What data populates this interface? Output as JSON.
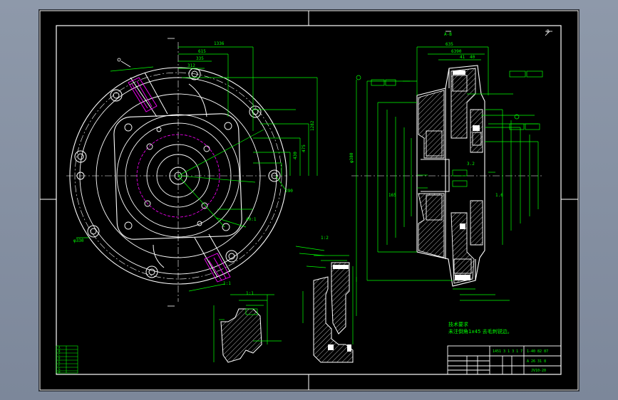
{
  "drawing": {
    "title_block": {
      "top_right_text": "1-40 82 87",
      "name_text": "A 26 31 8",
      "part_no": "JV10-20",
      "company": "1451 3 1 3 1 7"
    },
    "section_labels": {
      "section_ab": "A-B",
      "detail_1": "1:2",
      "detail_view": "1:1",
      "detail_scale": "1:1",
      "corner_mark": "B"
    },
    "dimensions": {
      "top_span": "1336",
      "top_1": "615",
      "top_2": "335",
      "top_3": "312",
      "right_span": "635",
      "right_a": "6390",
      "right_b": "41",
      "right_c": "40",
      "vertical_1": "1282",
      "vertical_2": "475",
      "vertical_3": "430",
      "vertical_4": "290",
      "left_phi": "φ330",
      "left_phi2": "φ380",
      "mid_1": "165",
      "mid_2": "1.6",
      "mid_3": "3.2",
      "scale_label": "40:1"
    },
    "notes": {
      "tech_req_title": "技术要求",
      "tech_req_line": "未注倒角1x45 去毛刺锐边。"
    },
    "legend_box": [
      "A",
      "B",
      "C",
      "D",
      "E",
      "F",
      "G",
      "H"
    ],
    "colors": {
      "background": "#000000",
      "frame": "#ffffff",
      "dimension": "#00ff00",
      "centerline": "#ffffff",
      "hatch": "#ffffff",
      "highlight": "#ff00ff",
      "section_fill": "#ffffff",
      "window_bg": "#8e99aa"
    }
  }
}
